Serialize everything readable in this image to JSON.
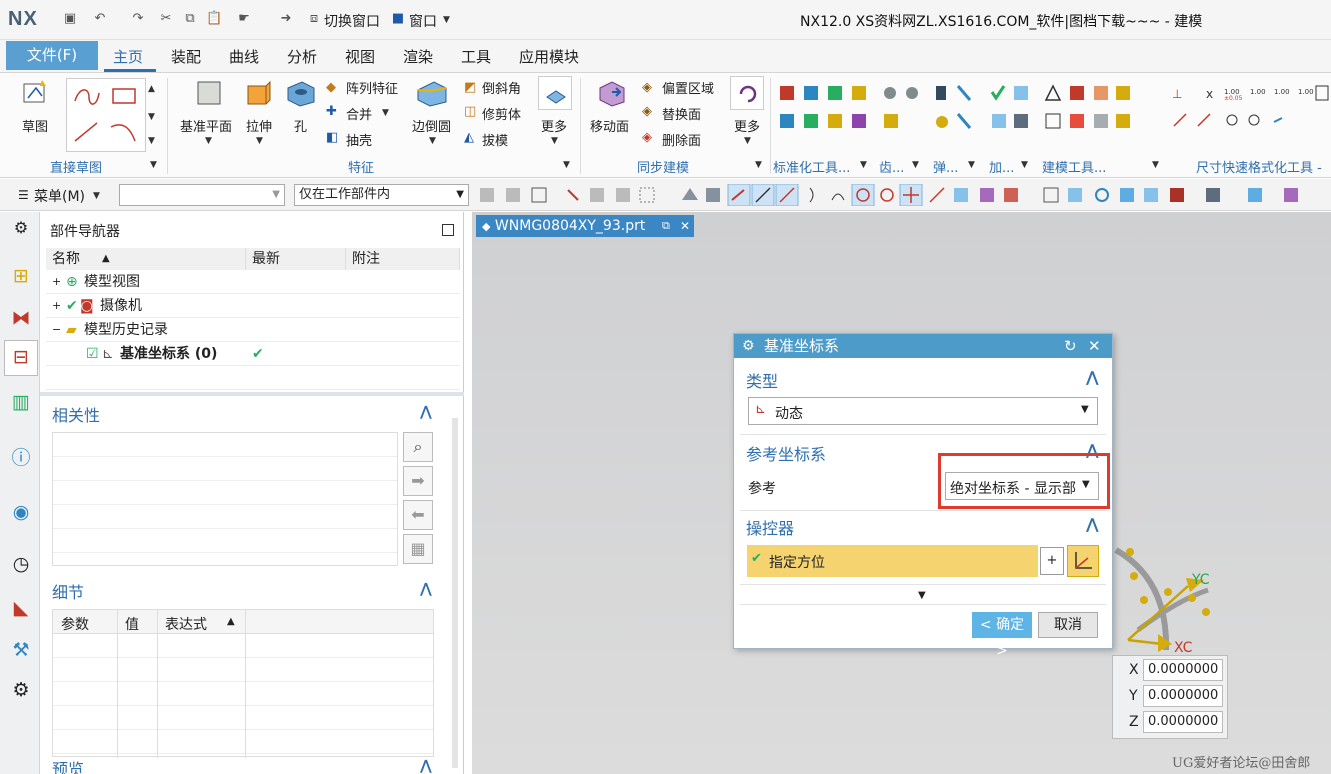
{
  "window": {
    "title": "NX12.0 XS资料网ZL.XS1616.COM_软件|图档下载~~~ - 建模",
    "logo": "NX",
    "quick_access": {
      "switch_window": "切换窗口",
      "window": "窗口"
    }
  },
  "menu_tabs": [
    "文件(F)",
    "主页",
    "装配",
    "曲线",
    "分析",
    "视图",
    "渲染",
    "工具",
    "应用模块"
  ],
  "active_tab": "主页",
  "ribbon": {
    "sketch": {
      "label": "草图",
      "group": "直接草图"
    },
    "feature": {
      "datum_plane": "基准平面",
      "extrude": "拉伸",
      "hole": "孔",
      "pattern": "阵列特征",
      "unite": "合并",
      "shell": "抽壳",
      "edge_blend": "边倒圆",
      "chamfer": "倒斜角",
      "trim_body": "修剪体",
      "draft": "拔模",
      "more": "更多",
      "group": "特征"
    },
    "sync": {
      "move_face": "移动面",
      "offset_region": "偏置区域",
      "replace_face": "替换面",
      "delete_face": "删除面",
      "more": "更多",
      "group": "同步建模"
    },
    "more_groups": [
      "标准化工具...",
      "齿...",
      "弹...",
      "加...",
      "建模工具...",
      "尺寸快速格式化工具 -"
    ]
  },
  "toolbar2": {
    "menu_label": "菜单(M)",
    "selection_filter": "",
    "scope": "仅在工作部件内"
  },
  "navigator": {
    "title": "部件导航器",
    "columns": [
      "名称",
      "最新",
      "附注"
    ],
    "nodes": [
      {
        "label": "模型视图",
        "latest": ""
      },
      {
        "label": "摄像机",
        "latest": ""
      },
      {
        "label": "模型历史记录",
        "latest": ""
      },
      {
        "label": "基准坐标系 (0)",
        "latest": "✔"
      }
    ],
    "dependencies": {
      "title": "相关性"
    },
    "details": {
      "title": "细节",
      "columns": [
        "参数",
        "值",
        "表达式"
      ]
    },
    "preview": {
      "title": "预览"
    }
  },
  "doc_tab": {
    "name": "WNMG0804XY_93.prt"
  },
  "dialog": {
    "title": "基准坐标系",
    "type_section": "类型",
    "type_value": "动态",
    "ref_section": "参考坐标系",
    "ref_label": "参考",
    "ref_value": "绝对坐标系 - 显示部件",
    "manip_section": "操控器",
    "specify_orientation": "指定方位",
    "ok": "< 确定 >",
    "cancel": "取消"
  },
  "triad": {
    "yc": "YC",
    "xc": "XC"
  },
  "coords": [
    {
      "axis": "X",
      "value": "0.0000000"
    },
    {
      "axis": "Y",
      "value": "0.0000000"
    },
    {
      "axis": "Z",
      "value": "0.0000000"
    }
  ],
  "watermark": "UG爱好者论坛@田舍郎",
  "colors": {
    "accent": "#2f6fae",
    "dialog_title": "#4d9bc9",
    "highlight": "#e03a2f",
    "specify_bar": "#f5d36e"
  }
}
